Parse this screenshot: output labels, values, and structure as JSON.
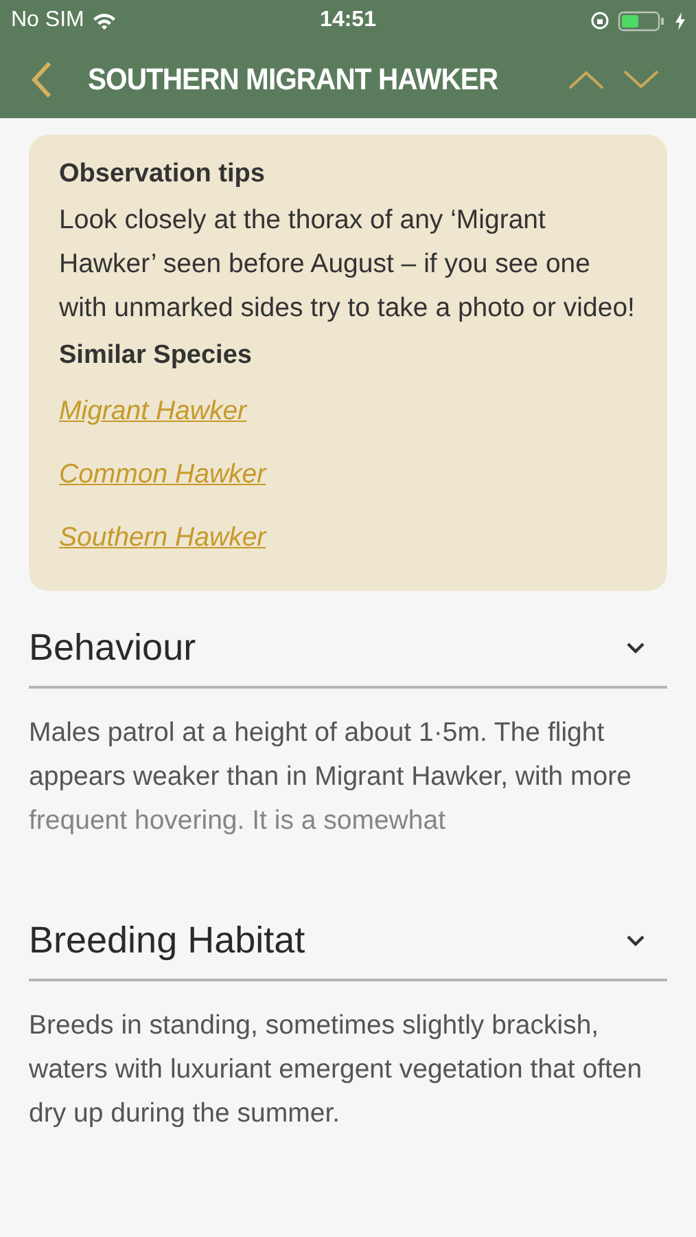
{
  "status_bar": {
    "carrier": "No SIM",
    "time": "14:51"
  },
  "nav": {
    "title": "SOUTHERN MIGRANT HAWKER"
  },
  "tips": {
    "title": "Observation tips",
    "text": "Look closely at the thorax of any ‘Migrant Hawker’ seen before August – if you see one with unmarked sides try to take a photo or video!",
    "similar_title": "Similar Species",
    "links": [
      "Migrant Hawker",
      "Common Hawker",
      "Southern Hawker"
    ]
  },
  "sections": [
    {
      "title": "Behaviour",
      "text": "Males patrol at a height of about 1·5m. The flight appears weaker than in Migrant Hawker, with more frequent hovering. It is a somewhat",
      "faded": true
    },
    {
      "title": "Breeding Habitat",
      "text": "Breeds in standing, sometimes slightly brackish, waters with luxuriant emergent vegetation that often dry up during the summer.",
      "faded": false
    }
  ]
}
